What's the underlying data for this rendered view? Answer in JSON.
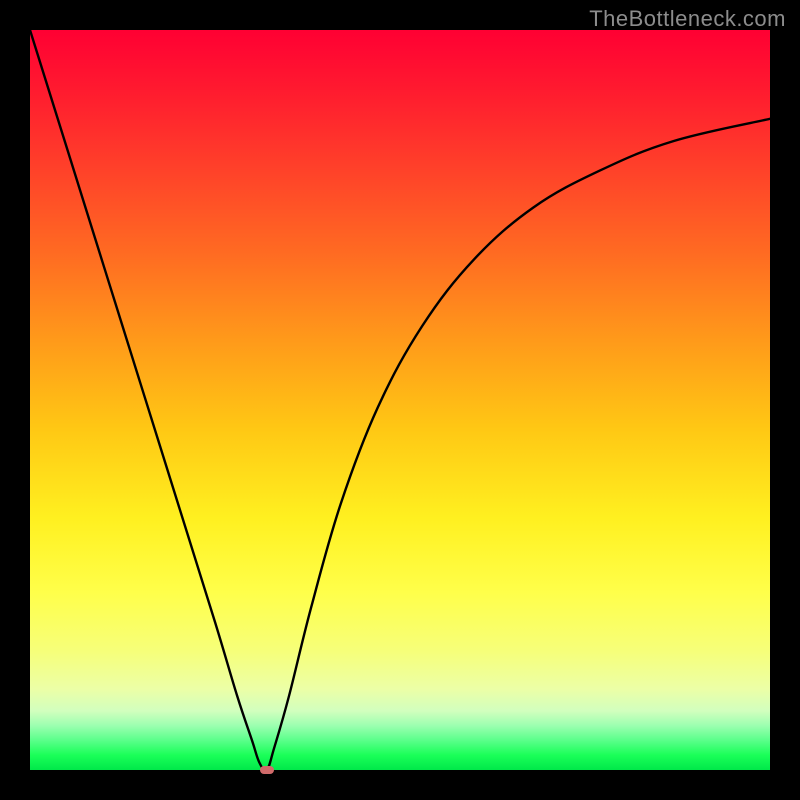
{
  "watermark": "TheBottleneck.com",
  "colors": {
    "frame": "#000000",
    "marker": "#d06a6a",
    "curve": "#000000"
  },
  "chart_data": {
    "type": "line",
    "title": "",
    "xlabel": "",
    "ylabel": "",
    "xlim": [
      0,
      100
    ],
    "ylim": [
      0,
      100
    ],
    "grid": false,
    "legend": false,
    "x": [
      0,
      5,
      10,
      15,
      20,
      25,
      28,
      30,
      31,
      32,
      33,
      35,
      38,
      42,
      47,
      53,
      60,
      68,
      77,
      87,
      100
    ],
    "y": [
      100,
      84,
      68,
      52,
      36,
      20,
      10,
      4,
      1,
      0,
      3,
      10,
      22,
      36,
      49,
      60,
      69,
      76,
      81,
      85,
      88
    ],
    "minimum_x": 32,
    "marker": {
      "x": 32,
      "y": 0
    }
  }
}
